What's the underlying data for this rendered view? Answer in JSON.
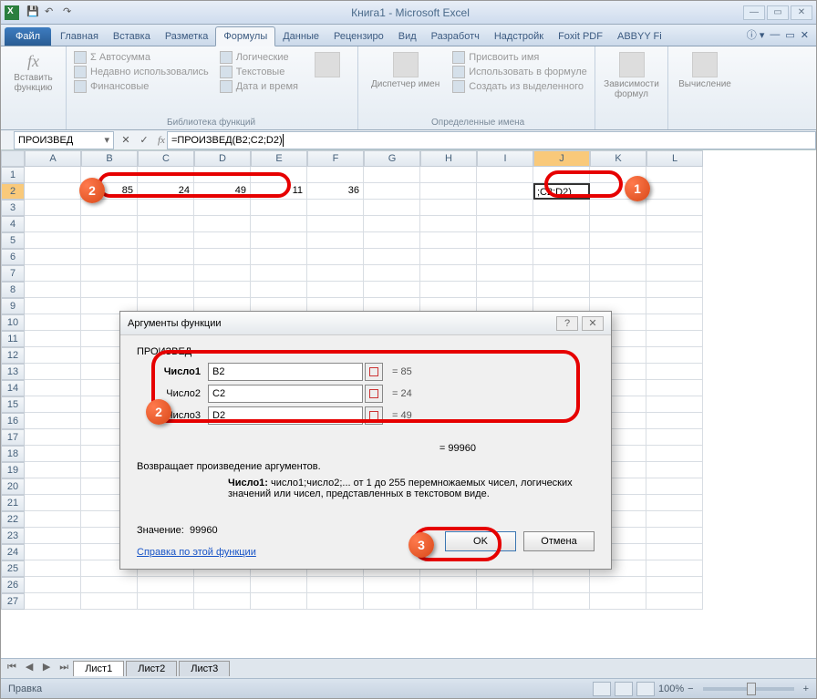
{
  "title": "Книга1 - Microsoft Excel",
  "qat": {
    "save": "💾",
    "undo": "↶",
    "redo": "↷"
  },
  "tabs": {
    "file": "Файл",
    "items": [
      "Главная",
      "Вставка",
      "Разметка",
      "Формулы",
      "Данные",
      "Рецензиро",
      "Вид",
      "Разработч",
      "Надстройк",
      "Foxit PDF",
      "ABBYY Fi"
    ],
    "active": 3
  },
  "ribbon": {
    "insert_fn": "Вставить функцию",
    "lib": [
      "Σ Автосумма",
      "Недавно использовались",
      "Финансовые"
    ],
    "lib2": [
      "Логические",
      "Текстовые",
      "Дата и время"
    ],
    "lib_label": "Библиотека функций",
    "name_mgr": "Диспетчер имен",
    "names": [
      "Присвоить имя",
      "Использовать в формуле",
      "Создать из выделенного"
    ],
    "names_label": "Определенные имена",
    "dep": "Зависимости формул",
    "calc": "Вычисление"
  },
  "namebox": "ПРОИЗВЕД",
  "formula": "=ПРОИЗВЕД(B2;C2;D2)",
  "cols": [
    "A",
    "B",
    "C",
    "D",
    "E",
    "F",
    "G",
    "H",
    "I",
    "J",
    "K",
    "L"
  ],
  "cells": {
    "B2": "85",
    "C2": "24",
    "D2": "49",
    "E2": "11",
    "F2": "36",
    "J2": ";C2;D2)"
  },
  "dialog": {
    "title": "Аргументы функции",
    "fn": "ПРОИЗВЕД",
    "args": [
      {
        "label": "Число1",
        "bold": true,
        "value": "B2",
        "result": "= 85"
      },
      {
        "label": "Число2",
        "bold": false,
        "value": "C2",
        "result": "= 24"
      },
      {
        "label": "Число3",
        "bold": false,
        "value": "D2",
        "result": "= 49"
      }
    ],
    "result": "= 99960",
    "desc": "Возвращает произведение аргументов.",
    "arg_desc_lbl": "Число1:",
    "arg_desc": "число1;число2;... от 1 до 255 перемножаемых чисел, логических значений или чисел, представленных в текстовом виде.",
    "value_lbl": "Значение:",
    "value": "99960",
    "help": "Справка по этой функции",
    "ok": "OK",
    "cancel": "Отмена"
  },
  "sheets": [
    "Лист1",
    "Лист2",
    "Лист3"
  ],
  "status": "Правка",
  "zoom": "100%",
  "callouts": {
    "1": "1",
    "2": "2",
    "2b": "2",
    "3": "3"
  }
}
